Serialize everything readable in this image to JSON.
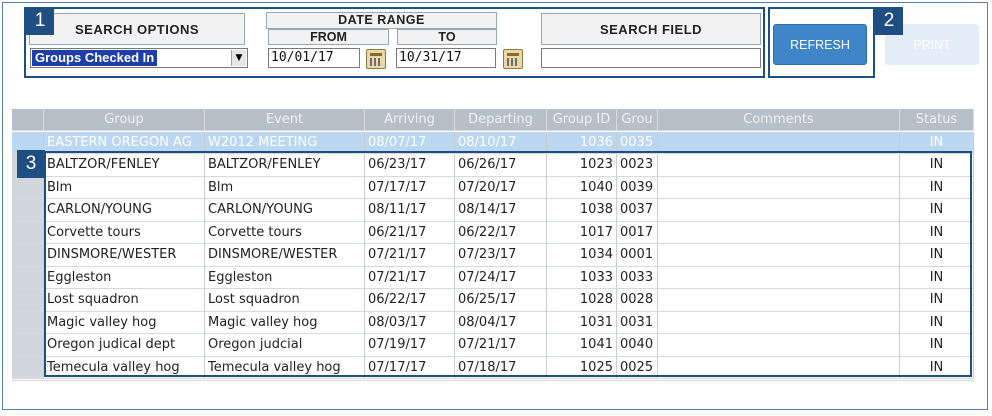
{
  "callouts": [
    "1",
    "2",
    "3"
  ],
  "search_options": {
    "title": "SEARCH  OPTIONS",
    "selected": "Groups Checked In"
  },
  "date_range": {
    "title": "DATE RANGE",
    "from_label": "FROM",
    "to_label": "TO",
    "from_value": "10/01/17",
    "to_value": "10/31/17"
  },
  "search_field": {
    "title": "SEARCH  FIELD",
    "value": ""
  },
  "buttons": {
    "refresh": "REFRESH",
    "print": "PRINT"
  },
  "table": {
    "headers": [
      "Group",
      "Event",
      "Arriving",
      "Departing",
      "Group ID",
      "Grou",
      "Comments",
      "Status"
    ],
    "rows": [
      [
        "EASTERN OREGON AG",
        "W2012 MEETING",
        "08/07/17",
        "08/10/17",
        "1036",
        "0035",
        "",
        "IN"
      ],
      [
        "BALTZOR/FENLEY",
        "BALTZOR/FENLEY",
        "06/23/17",
        "06/26/17",
        "1023",
        "0023",
        "",
        "IN"
      ],
      [
        "Blm",
        "Blm",
        "07/17/17",
        "07/20/17",
        "1040",
        "0039",
        "",
        "IN"
      ],
      [
        "CARLON/YOUNG",
        "CARLON/YOUNG",
        "08/11/17",
        "08/14/17",
        "1038",
        "0037",
        "",
        "IN"
      ],
      [
        "Corvette tours",
        "Corvette tours",
        "06/21/17",
        "06/22/17",
        "1017",
        "0017",
        "",
        "IN"
      ],
      [
        "DINSMORE/WESTER",
        "DINSMORE/WESTER",
        "07/21/17",
        "07/23/17",
        "1034",
        "0001",
        "",
        "IN"
      ],
      [
        "Eggleston",
        "Eggleston",
        "07/21/17",
        "07/24/17",
        "1033",
        "0033",
        "",
        "IN"
      ],
      [
        "Lost squadron",
        "Lost squadron",
        "06/22/17",
        "06/25/17",
        "1028",
        "0028",
        "",
        "IN"
      ],
      [
        "Magic valley hog",
        "Magic valley hog",
        "08/03/17",
        "08/04/17",
        "1031",
        "0031",
        "",
        "IN"
      ],
      [
        "Oregon judical dept",
        "Oregon judcial",
        "07/19/17",
        "07/21/17",
        "1041",
        "0040",
        "",
        "IN"
      ],
      [
        "Temecula valley hog",
        "Temecula valley hog",
        "07/17/17",
        "07/18/17",
        "1025",
        "0025",
        "",
        "IN"
      ]
    ]
  },
  "colors": {
    "callout": "#1f4e82",
    "refresh_button": "#3f86c9",
    "selected_row": "#bcd7f0",
    "header": "#b7bfc9"
  }
}
